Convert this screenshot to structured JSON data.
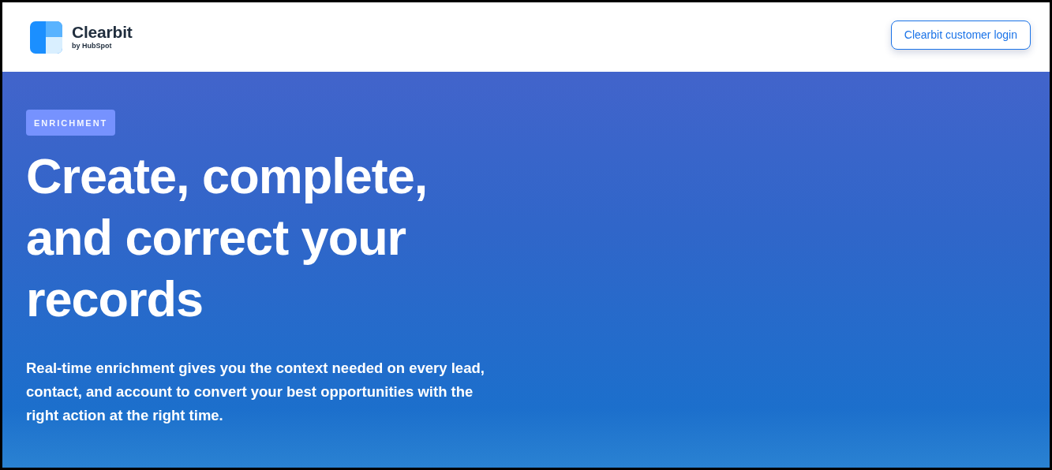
{
  "header": {
    "logo": {
      "name": "Clearbit",
      "tagline": "by HubSpot"
    },
    "login_button": "Clearbit customer login"
  },
  "hero": {
    "badge": "ENRICHMENT",
    "heading": "Create, complete, and correct your records",
    "description": "Real-time enrichment gives you the context needed on every lead, contact, and account to convert your best opportunities with the right action at the right time."
  }
}
